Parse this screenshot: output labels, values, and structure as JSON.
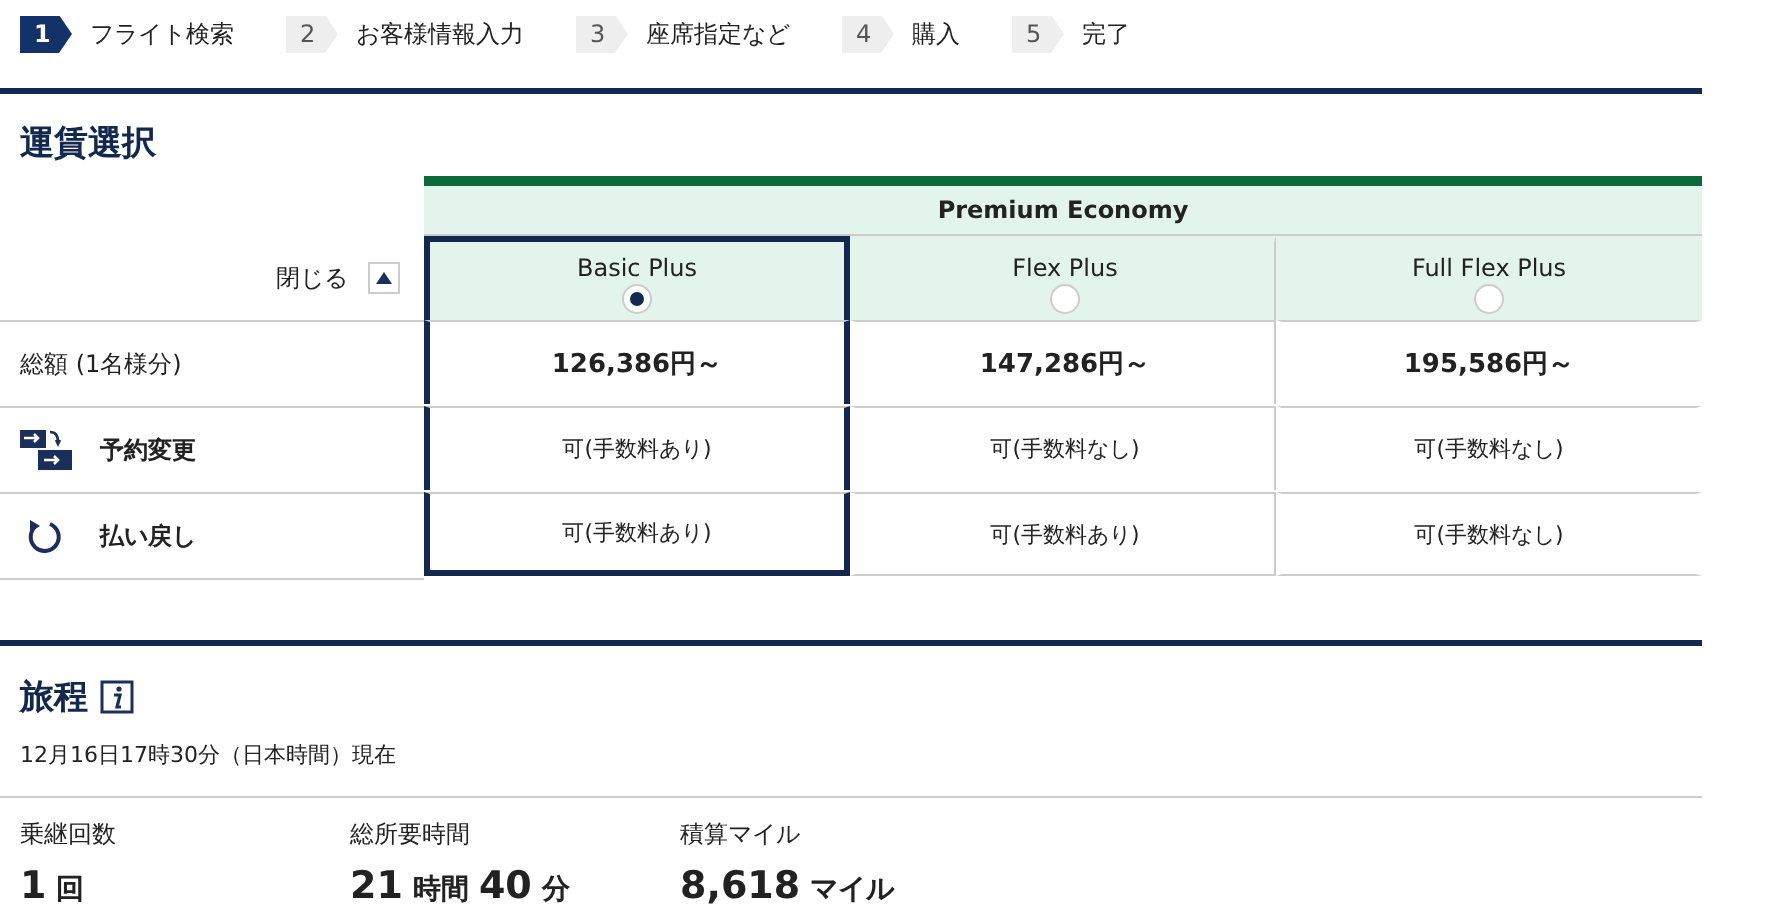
{
  "steps": [
    {
      "number": "1",
      "label": "フライト検索",
      "selected": true
    },
    {
      "number": "2",
      "label": "お客様情報入力",
      "selected": false
    },
    {
      "number": "3",
      "label": "座席指定など",
      "selected": false
    },
    {
      "number": "4",
      "label": "購入",
      "selected": false
    },
    {
      "number": "5",
      "label": "完了",
      "selected": false
    }
  ],
  "fare_section": {
    "title": "運賃選択",
    "close_label": "閉じる",
    "cabin": "Premium Economy",
    "row_labels": {
      "total": "総額 (1名様分)",
      "change": "予約変更",
      "refund": "払い戻し"
    },
    "plans": [
      {
        "name": "Basic Plus",
        "selected": true,
        "price": "126,386円～",
        "change": "可(手数料あり)",
        "refund": "可(手数料あり)"
      },
      {
        "name": "Flex Plus",
        "selected": false,
        "price": "147,286円～",
        "change": "可(手数料なし)",
        "refund": "可(手数料あり)"
      },
      {
        "name": "Full Flex Plus",
        "selected": false,
        "price": "195,586円～",
        "change": "可(手数料なし)",
        "refund": "可(手数料なし)"
      }
    ]
  },
  "itinerary": {
    "title": "旅程",
    "as_of": "12月16日17時30分（日本時間）現在",
    "stats": [
      {
        "label": "乗継回数",
        "parts": [
          {
            "text": "1",
            "kind": "number"
          },
          {
            "text": "回",
            "kind": "unit"
          }
        ]
      },
      {
        "label": "総所要時間",
        "parts": [
          {
            "text": "21",
            "kind": "number"
          },
          {
            "text": "時間",
            "kind": "unit"
          },
          {
            "text": "40",
            "kind": "number"
          },
          {
            "text": "分",
            "kind": "unit"
          }
        ]
      },
      {
        "label": "積算マイル",
        "parts": [
          {
            "text": "8,618",
            "kind": "number"
          },
          {
            "text": "マイル",
            "kind": "unit"
          }
        ]
      }
    ]
  }
}
